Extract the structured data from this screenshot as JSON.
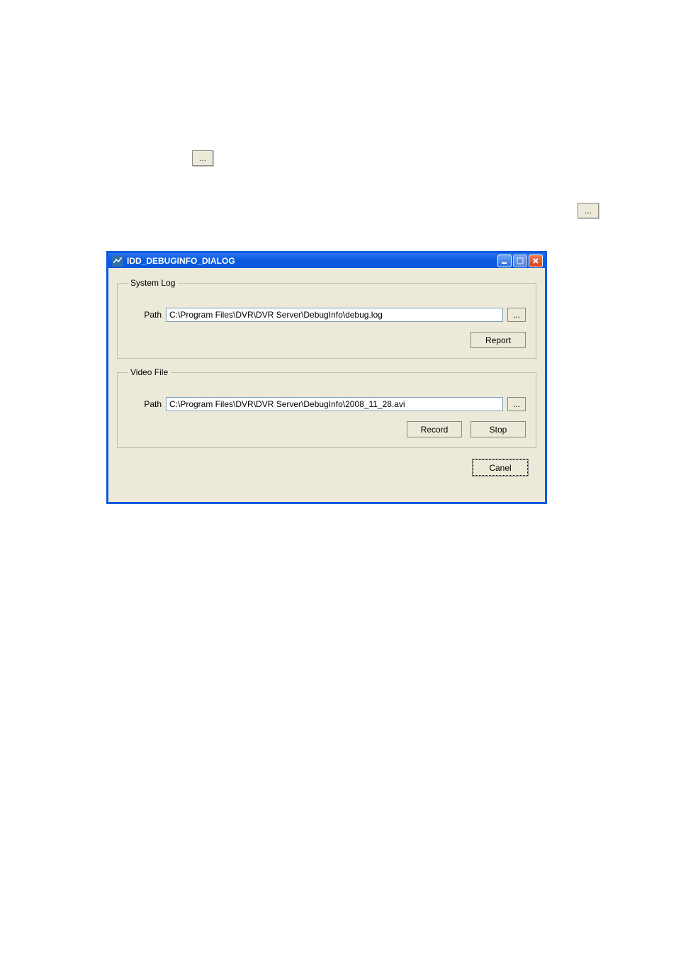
{
  "lone_buttons": {
    "b1": "...",
    "b2": "..."
  },
  "dialog": {
    "title": "IDD_DEBUGINFO_DIALOG",
    "system_log": {
      "legend": "System Log",
      "path_label": "Path",
      "path_value": "C:\\Program Files\\DVR\\DVR Server\\DebugInfo\\debug.log",
      "browse": "...",
      "report": "Report"
    },
    "video_file": {
      "legend": "Video File",
      "path_label": "Path",
      "path_value": "C:\\Program Files\\DVR\\DVR Server\\DebugInfo\\2008_11_28.avi",
      "browse": "...",
      "record": "Record",
      "stop": "Stop"
    },
    "cancel": "Canel"
  }
}
